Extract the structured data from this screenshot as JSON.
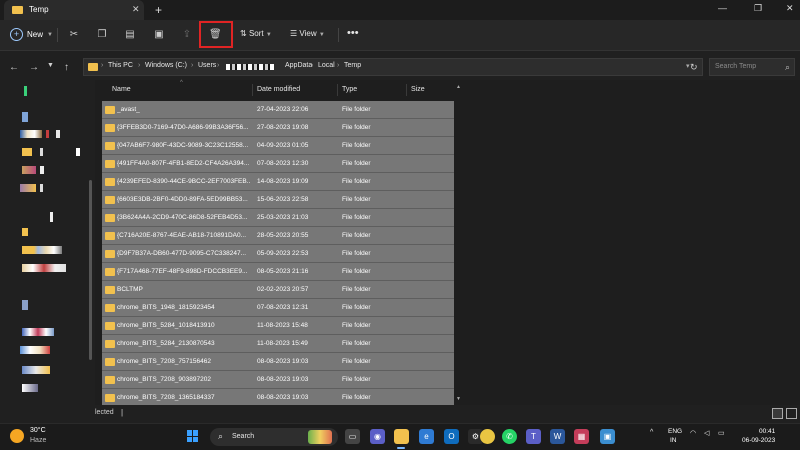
{
  "window": {
    "tab_title": "Temp",
    "tab_close": "✕",
    "tab_add": "+",
    "minimize": "—",
    "maximize": "❐",
    "close": "✕"
  },
  "toolbar": {
    "new_label": "New",
    "sort_label": "Sort",
    "view_label": "View",
    "more": "•••"
  },
  "address": {
    "crumbs": [
      "This PC",
      "Windows (C:)",
      "Users",
      "AppData",
      "Local",
      "Temp"
    ],
    "search_placeholder": "Search Temp"
  },
  "columns": {
    "name": "Name",
    "date": "Date modified",
    "type": "Type",
    "size": "Size"
  },
  "rows": [
    {
      "name": "_avast_",
      "date": "27-04-2023 22:06",
      "type": "File folder"
    },
    {
      "name": "{3FFEB3D0-7169-47D0-A686-99B3A36F56...",
      "date": "27-08-2023 19:08",
      "type": "File folder"
    },
    {
      "name": "{047AB6F7-980F-43DC-9089-3C23C12558...",
      "date": "04-09-2023 01:05",
      "type": "File folder"
    },
    {
      "name": "{491FF4A0-807F-4FB1-8ED2-CF4A26A394...",
      "date": "07-08-2023 12:30",
      "type": "File folder"
    },
    {
      "name": "{4239EFED-8390-44CE-9BCC-2EF7003FEB...",
      "date": "14-08-2023 19:09",
      "type": "File folder"
    },
    {
      "name": "{6603E3DB-2BF0-4DD0-89FA-5ED99BB53...",
      "date": "15-06-2023 22:58",
      "type": "File folder"
    },
    {
      "name": "{3B624A4A-2CD9-470C-86D8-52FEB4D53...",
      "date": "25-03-2023 21:03",
      "type": "File folder"
    },
    {
      "name": "{C716A20E-8767-4EAE-AB18-710891DA0...",
      "date": "28-05-2023 20:55",
      "type": "File folder"
    },
    {
      "name": "{D9F7B37A-DB60-477D-9095-C7C338247...",
      "date": "05-09-2023 22:53",
      "type": "File folder"
    },
    {
      "name": "{F717A468-77EF-48F9-898D-FDCCB3EE9...",
      "date": "08-05-2023 21:16",
      "type": "File folder"
    },
    {
      "name": "BCLTMP",
      "date": "02-02-2023 20:57",
      "type": "File folder"
    },
    {
      "name": "chrome_BITS_1948_1815923454",
      "date": "07-08-2023 12:31",
      "type": "File folder"
    },
    {
      "name": "chrome_BITS_5284_1018413910",
      "date": "11-08-2023 15:48",
      "type": "File folder"
    },
    {
      "name": "chrome_BITS_5284_2130870543",
      "date": "11-08-2023 15:49",
      "type": "File folder"
    },
    {
      "name": "chrome_BITS_7208_757156462",
      "date": "08-08-2023 19:03",
      "type": "File folder"
    },
    {
      "name": "chrome_BITS_7208_903897202",
      "date": "08-08-2023 19:03",
      "type": "File folder"
    },
    {
      "name": "chrome_BITS_7208_1365184337",
      "date": "08-08-2023 19:03",
      "type": "File folder"
    }
  ],
  "status": {
    "text": "lected"
  },
  "taskbar": {
    "weather_temp": "30°C",
    "weather_desc": "Haze",
    "search_label": "Search",
    "lang_line1": "ENG",
    "lang_line2": "IN",
    "time": "00:41",
    "date": "06-09-2023"
  },
  "colors": {
    "row_selected": "#777777",
    "folder": "#f2c14e",
    "highlight_box": "#e02424",
    "accent": "#3aa0ff"
  }
}
